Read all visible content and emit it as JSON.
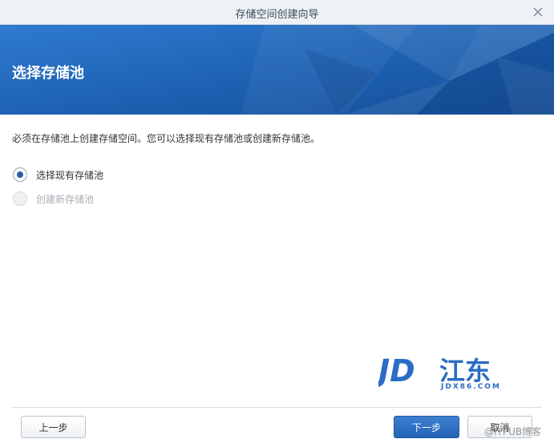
{
  "window": {
    "title": "存储空间创建向导",
    "close_icon": "close-icon"
  },
  "banner": {
    "heading": "选择存储池"
  },
  "description": "必须在存储池上创建存储空间。您可以选择现有存储池或创建新存储池。",
  "options": [
    {
      "label": "选择现有存储池",
      "checked": true,
      "enabled": true
    },
    {
      "label": "创建新存储池",
      "checked": false,
      "enabled": false
    }
  ],
  "logo": {
    "brand": "JD",
    "cn_text": "江东",
    "sub_text": "JDX86.COM"
  },
  "buttons": {
    "prev": "上一步",
    "next": "下一步",
    "cancel": "取消"
  },
  "watermark": "@ITPUB博客",
  "colors": {
    "banner": "#1f64b3",
    "primary_button": "#2a6ac0",
    "logo_blue": "#2b6cc4"
  }
}
